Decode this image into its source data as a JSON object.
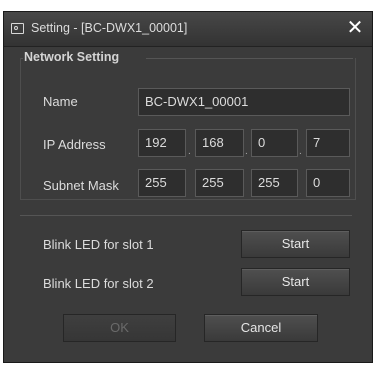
{
  "window": {
    "title": "Setting - [BC-DWX1_00001]",
    "close_glyph": "✕"
  },
  "network_setting": {
    "group_title": "Network Setting",
    "name_label": "Name",
    "name_value": "BC-DWX1_00001",
    "ip_label": "IP Address",
    "ip": [
      "192",
      "168",
      "0",
      "7"
    ],
    "subnet_label": "Subnet Mask",
    "subnet": [
      "255",
      "255",
      "255",
      "0"
    ],
    "octet_separator": "."
  },
  "blink": {
    "slot1_label": "Blink LED for slot 1",
    "slot1_button": "Start",
    "slot2_label": "Blink LED for slot 2",
    "slot2_button": "Start"
  },
  "footer": {
    "ok_label": "OK",
    "cancel_label": "Cancel"
  },
  "icons": {
    "title_icon": "settings-window-icon",
    "close": "close-icon"
  }
}
